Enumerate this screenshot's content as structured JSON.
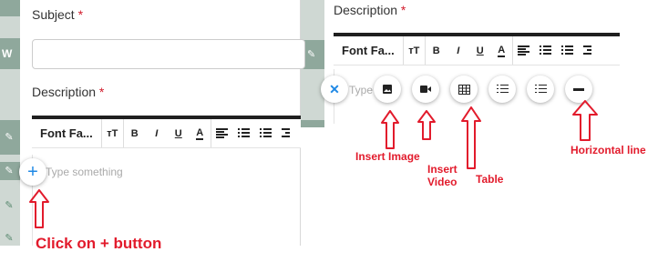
{
  "left": {
    "subject_label": "Subject",
    "required_mark": "*",
    "description_label": "Description",
    "toolbar": {
      "font_label": "Font Fa...",
      "bold": "B",
      "italic": "I",
      "underline": "U",
      "color": "A"
    },
    "placeholder": "Type something",
    "side_letter": "W"
  },
  "right": {
    "description_label": "Description",
    "required_mark": "*",
    "toolbar": {
      "font_label": "Font Fa...",
      "bold": "B",
      "italic": "I",
      "underline": "U",
      "color": "A"
    },
    "placeholder": "Type"
  },
  "annotations": {
    "click_plus": "Click on + button",
    "insert_image": "Insert Image",
    "insert_video_1": "Insert",
    "insert_video_2": "Video",
    "table": "Table",
    "horizontal_line": "Horizontal line"
  },
  "colors": {
    "annotation_red": "#e21b2c",
    "accent_blue": "#1e88e5"
  }
}
